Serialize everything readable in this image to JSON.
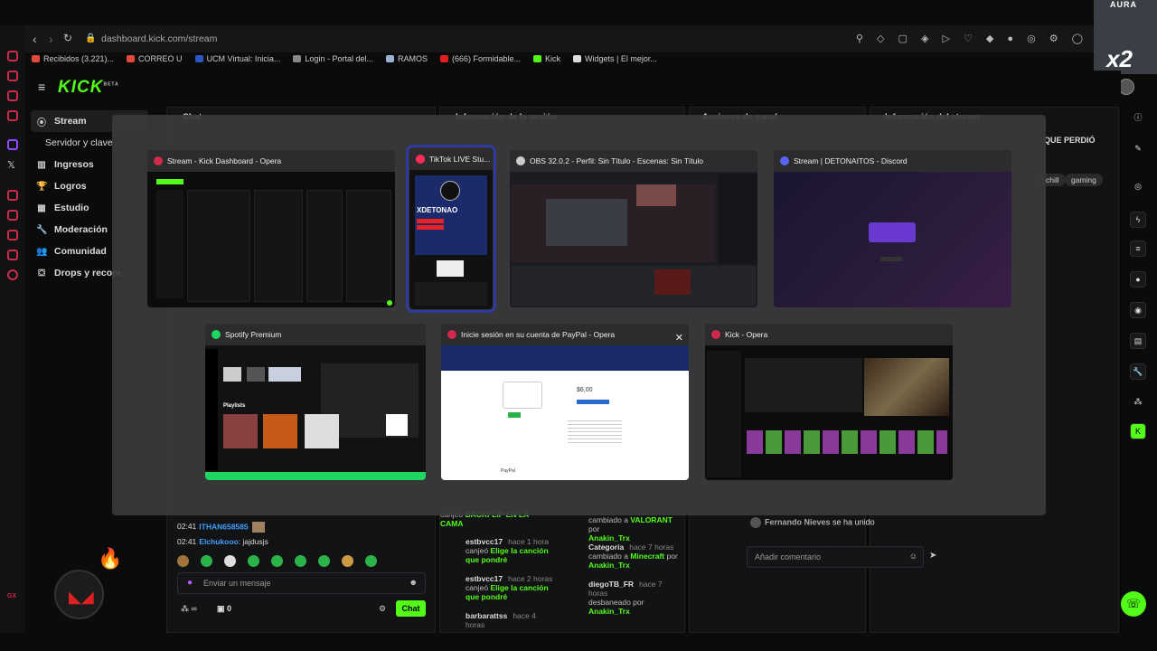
{
  "browser": {
    "url_domain": "dashboard.kick.com",
    "url_path": "/stream",
    "bookmarks": [
      {
        "label": "Recibidos (3.221)...",
        "color": "#e04a3b"
      },
      {
        "label": "CORREO U",
        "color": "#e04a3b"
      },
      {
        "label": "UCM Virtual: Inicia...",
        "color": "#2b56c7"
      },
      {
        "label": "Login - Portal del...",
        "color": "#888888"
      },
      {
        "label": "RAMOS",
        "color": "#9ab0d0"
      },
      {
        "label": "(666) Formidable...",
        "color": "#e02020"
      },
      {
        "label": "Kick",
        "color": "#53fc18"
      },
      {
        "label": "Widgets | El mejor...",
        "color": "#dddddd"
      }
    ]
  },
  "kick": {
    "logo": "KICK",
    "beta": "BETA",
    "accent": "#53fc18",
    "nav": [
      {
        "label": "Stream",
        "icon": "broadcast-icon"
      },
      {
        "label": "Servidor y clave",
        "icon": ""
      },
      {
        "label": "Ingresos",
        "icon": "chart-icon"
      },
      {
        "label": "Logros",
        "icon": "trophy-icon"
      },
      {
        "label": "Estudio",
        "icon": "studio-icon"
      },
      {
        "label": "Moderación",
        "icon": "wrench-icon"
      },
      {
        "label": "Comunidad",
        "icon": "people-icon"
      },
      {
        "label": "Drops y recom",
        "icon": "gift-icon"
      }
    ],
    "panels": {
      "chat": "Chat",
      "session": "Información de la sesión",
      "actions": "Acciones de canal",
      "stream_info": "Información del stream"
    },
    "stream_title_fragment": "QUE PERDIÓ",
    "tags": [
      "chill",
      "gaming"
    ]
  },
  "chat": {
    "messages": [
      {
        "time": "02:41",
        "user": "ITHAN658585",
        "text": ""
      },
      {
        "time": "02:41",
        "user": "Elchukooo",
        "text": ": jajdusjs"
      }
    ],
    "input_placeholder": "Enviar un mensaje",
    "points": "∞",
    "count": "0",
    "send_label": "Chat"
  },
  "rewards": [
    {
      "user": "",
      "time": "",
      "desc": "canjeó",
      "reward": "BACKFLIP EN LA CAMA"
    },
    {
      "user": "estbvcc17",
      "time": "hace 1 hora",
      "desc": "canjeó",
      "reward": "Elige la canción que pondré"
    },
    {
      "user": "estbvcc17",
      "time": "hace 2 horas",
      "desc": "canjeó",
      "reward": "Elige la canción que pondré"
    },
    {
      "user": "barbarattss",
      "time": "hace 4 horas",
      "desc": "",
      "reward": ""
    }
  ],
  "actions": [
    {
      "title": "",
      "time": "",
      "line1": "cambiado a",
      "value": "VALORANT",
      "by": "por",
      "who": "Anakin_Trx"
    },
    {
      "title": "Categoría",
      "time": "hace 7 horas",
      "line1": "cambiado a",
      "value": "Minecraft",
      "by": "por",
      "who": "Anakin_Trx"
    },
    {
      "title": "diegoTB_FR",
      "time": "hace 7 horas",
      "line1": "desbaneado por",
      "value": "",
      "by": "",
      "who": "Anakin_Trx"
    }
  ],
  "activity": {
    "joined_user": "Fernando Nieves",
    "joined_text": "se ha unido",
    "comment_placeholder": "Añadir comentario"
  },
  "webcam": {
    "tag": "AURA",
    "multiplier": "x2"
  },
  "overlay_windows": [
    {
      "title": "Stream - Kick Dashboard - Opera",
      "icon_color": "#d02a4a"
    },
    {
      "title": "TikTok LIVE Stu...",
      "icon_color": "#ff2d55",
      "selected": true,
      "label": "XDETONAO"
    },
    {
      "title": "OBS 32.0.2 - Perfil: Sin Título - Escenas: Sin Título",
      "icon_color": "#cccccc"
    },
    {
      "title": "Stream | DETONAITOS - Discord",
      "icon_color": "#5865f2"
    },
    {
      "title": "Spotify Premium",
      "icon_color": "#1ed760"
    },
    {
      "title": "Inicie sesión en su cuenta de PayPal - Opera",
      "icon_color": "#d02a4a",
      "paypal_amount": "$6,00",
      "paypal_footer": "PayPal"
    },
    {
      "title": "Kick - Opera",
      "icon_color": "#d02a4a"
    }
  ],
  "overlay_close": "✕",
  "spotify_section": "Playlists"
}
